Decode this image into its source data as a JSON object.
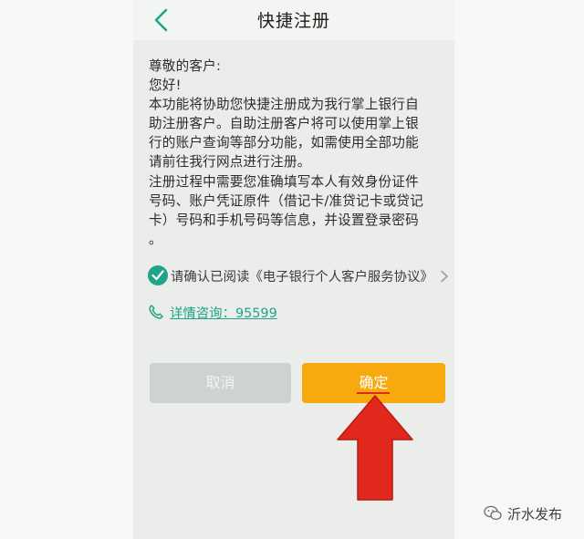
{
  "header": {
    "title": "快捷注册"
  },
  "notice": {
    "greeting": "尊敬的客户:",
    "hello": "您好!",
    "paragraph1_lines": [
      "本功能将协助您快捷注册成为我行掌上银行自",
      "助注册客户。自助注册客户将可以使用掌上银",
      "行的账户查询等部分功能，如需使用全部功能",
      "请前往我行网点进行注册。"
    ],
    "paragraph2_lines": [
      "注册过程中需要您准确填写本人有效身份证件",
      "号码、账户凭证原件（借记卡/准贷记卡或贷记",
      "卡）号码和手机号码等信息，并设置登录密码",
      "。"
    ]
  },
  "agreement": {
    "label": "请确认已阅读《电子银行个人客户服务协议》",
    "checked": true
  },
  "consult": {
    "label": "详情咨询：95599"
  },
  "buttons": {
    "cancel_label": "取消",
    "confirm_label": "确定"
  },
  "watermark": {
    "label": "沂水发布"
  },
  "colors": {
    "accent_green": "#1ea487",
    "confirm_orange": "#f7a90e",
    "cancel_gray": "#cfd3cf",
    "annotation_red": "#e0281c"
  },
  "icons": {
    "back": "chevron-left-icon",
    "check": "check-circle-icon",
    "more": "chevron-right-icon",
    "phone": "phone-icon",
    "annotation": "red-up-arrow-icon",
    "watermark": "wechat-icon"
  }
}
